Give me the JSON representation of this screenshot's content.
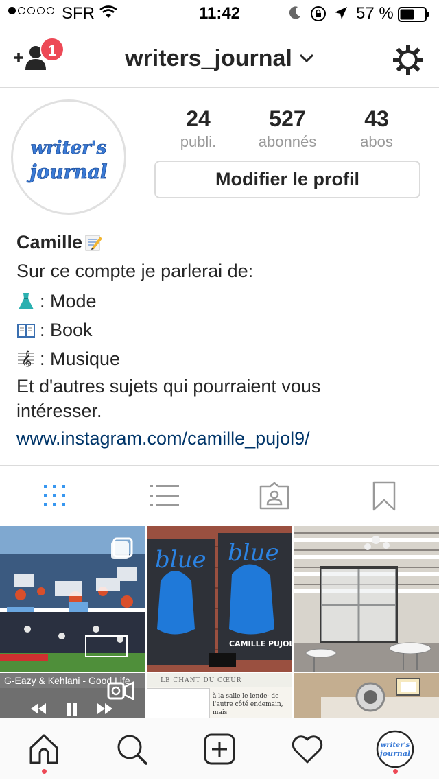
{
  "status_bar": {
    "carrier": "SFR",
    "time": "11:42",
    "battery_pct": "57 %",
    "battery_level": 0.57
  },
  "nav": {
    "username": "writers_journal",
    "notification_count": "1"
  },
  "profile": {
    "avatar_text_1": "writer's",
    "avatar_text_2": "journal",
    "stats": [
      {
        "value": "24",
        "label": "publi."
      },
      {
        "value": "527",
        "label": "abonnés"
      },
      {
        "value": "43",
        "label": "abos"
      }
    ],
    "edit_button": "Modifier le profil"
  },
  "bio": {
    "name": "Camille",
    "line1": "Sur ce compte je parlerai de:",
    "items": [
      {
        "icon": "dress-emoji",
        "text": ": Mode"
      },
      {
        "icon": "book-emoji",
        "text": ": Book"
      },
      {
        "icon": "music-score-emoji",
        "text": ": Musique"
      }
    ],
    "line2a": "Et d'autres sujets qui pourraient vous",
    "line2b": "intéresser.",
    "link": "www.instagram.com/camille_pujol9/"
  },
  "tabs": [
    {
      "icon": "grid-icon",
      "active": true
    },
    {
      "icon": "list-icon",
      "active": false
    },
    {
      "icon": "tagged-icon",
      "active": false
    },
    {
      "icon": "saved-icon",
      "active": false
    }
  ],
  "grid": {
    "post1_label": "",
    "post2_title": "blue",
    "post2_author": "CAMILLE PUJOL",
    "post4_caption": "G-Eazy & Kehlani - Good Life",
    "post5_header": "LE CHANT DU CŒUR",
    "post5_snippet": "à la salle le lende- de l'autre côté endemain, mais"
  },
  "bottom_nav": {
    "items": [
      "home-icon",
      "search-icon",
      "add-icon",
      "heart-icon",
      "profile-avatar"
    ],
    "profile_text_1": "writer's",
    "profile_text_2": "journal"
  },
  "colors": {
    "accent_blue": "#3897f0",
    "link_blue": "#003569",
    "badge_red": "#ed4956",
    "border": "#dbdbdb",
    "muted_text": "#999999"
  }
}
